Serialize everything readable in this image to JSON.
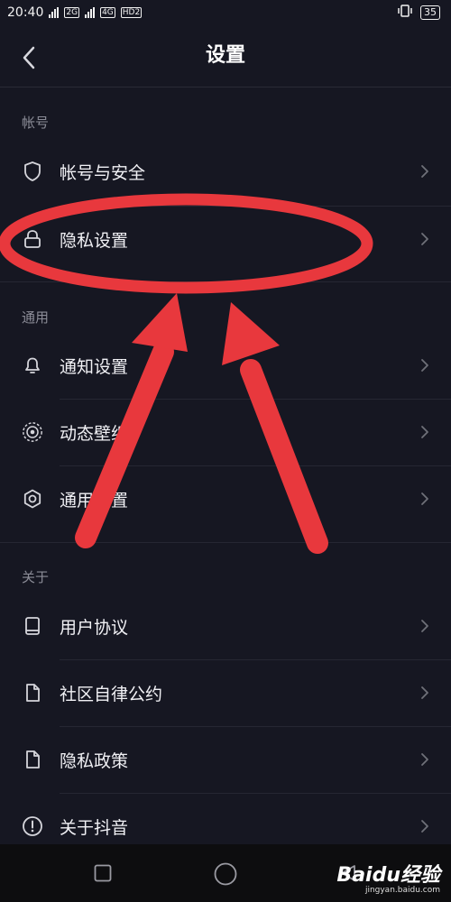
{
  "status_bar": {
    "time": "20:40",
    "sim1": "2G",
    "sim2": "4G",
    "hd": "HD2",
    "battery": "35"
  },
  "header": {
    "title": "设置"
  },
  "sections": {
    "account": {
      "label": "帐号",
      "items": [
        {
          "label": "帐号与安全",
          "icon": "shield-icon"
        },
        {
          "label": "隐私设置",
          "icon": "lock-icon"
        }
      ]
    },
    "general": {
      "label": "通用",
      "items": [
        {
          "label": "通知设置",
          "icon": "bell-icon"
        },
        {
          "label": "动态壁纸",
          "icon": "wallpaper-icon"
        },
        {
          "label": "通用设置",
          "icon": "gear-icon"
        }
      ]
    },
    "about": {
      "label": "关于",
      "items": [
        {
          "label": "用户协议",
          "icon": "book-icon"
        },
        {
          "label": "社区自律公约",
          "icon": "document-icon"
        },
        {
          "label": "隐私政策",
          "icon": "document-icon"
        },
        {
          "label": "关于抖音",
          "icon": "info-icon"
        }
      ]
    }
  },
  "annotation": {
    "color": "#e8383d",
    "highlight": "privacy-settings"
  },
  "watermark": {
    "brand": "Baidu经验",
    "url": "jingyan.baidu.com"
  }
}
